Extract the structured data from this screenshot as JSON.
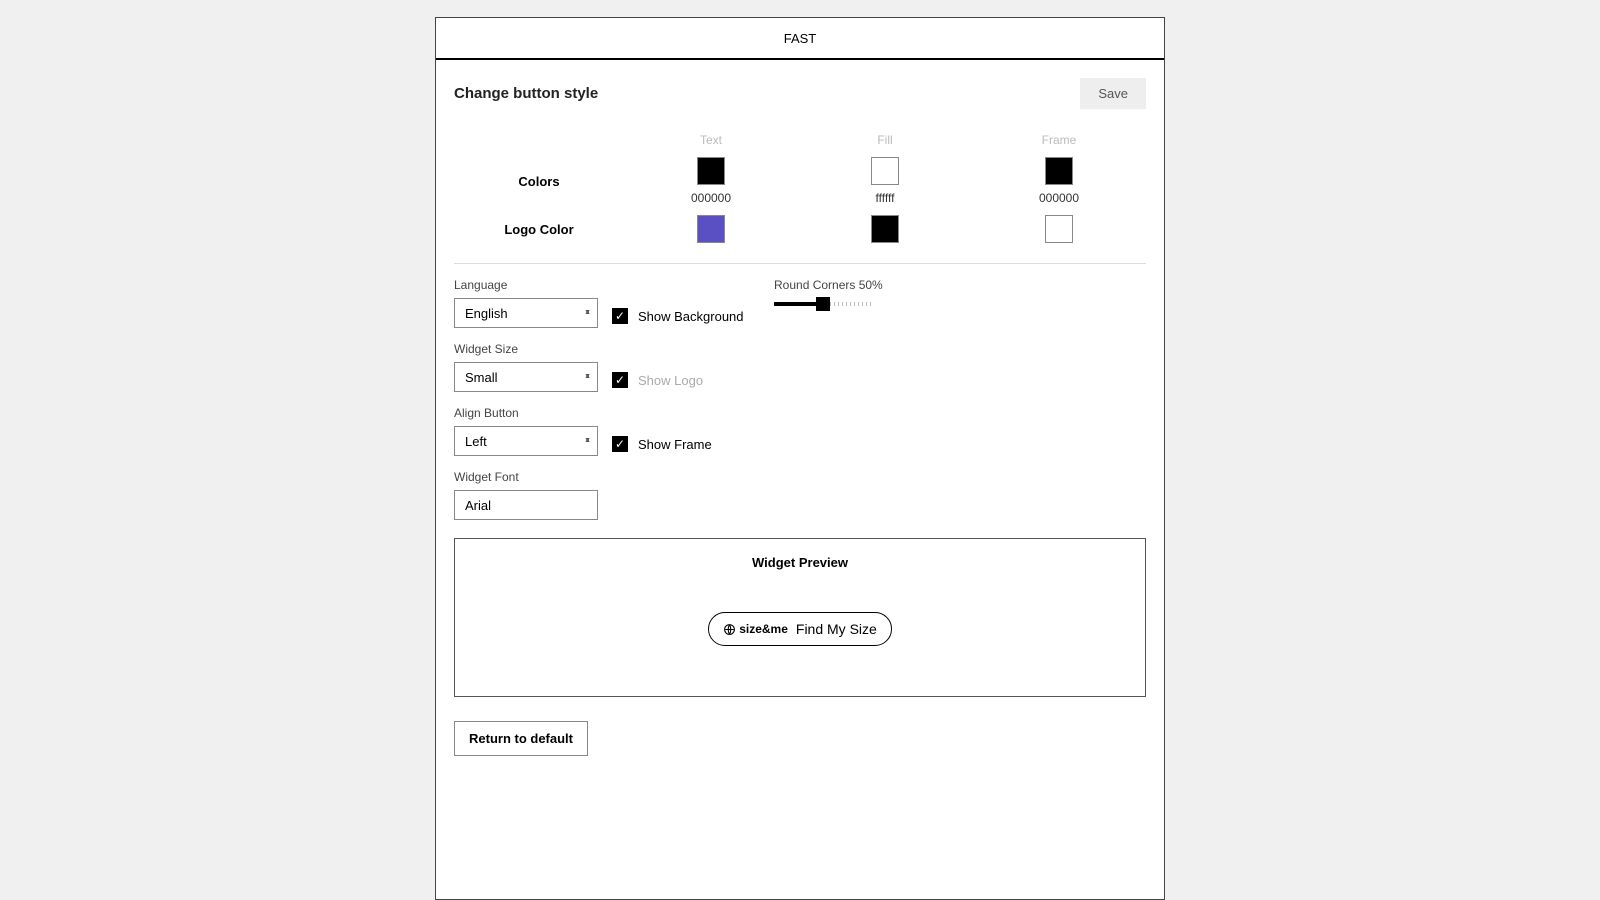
{
  "tab": "FAST",
  "title": "Change button style",
  "save": "Save",
  "colors": {
    "rowColors": "Colors",
    "rowLogo": "Logo Color",
    "col": {
      "text": "Text",
      "fill": "Fill",
      "frame": "Frame"
    },
    "text": {
      "hex": "000000",
      "val": "#000000"
    },
    "fill": {
      "hex": "ffffff",
      "val": "#ffffff"
    },
    "frame": {
      "hex": "000000",
      "val": "#000000"
    },
    "logo1": "#5b4fc4",
    "logo2": "#000000",
    "logo3": "#ffffff"
  },
  "language": {
    "label": "Language",
    "value": "English"
  },
  "widgetSize": {
    "label": "Widget Size",
    "value": "Small"
  },
  "alignButton": {
    "label": "Align Button",
    "value": "Left"
  },
  "widgetFont": {
    "label": "Widget Font",
    "value": "Arial"
  },
  "checks": {
    "bg": "Show Background",
    "logo": "Show Logo",
    "frame": "Show Frame"
  },
  "slider": {
    "label": "Round Corners 50%"
  },
  "preview": {
    "title": "Widget Preview",
    "logo": "size&me",
    "button": "Find My Size"
  },
  "returnDefault": "Return to default"
}
